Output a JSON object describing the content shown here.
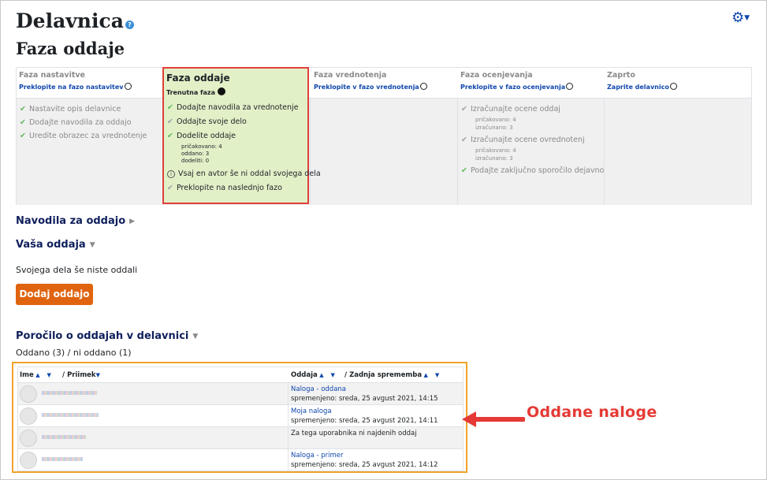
{
  "page": {
    "title": "Delavnica",
    "subtitle": "Faza oddaje",
    "help_icon": "question-circle-icon",
    "settings_icon": "gear-icon"
  },
  "phases": [
    {
      "name": "Faza nastavitve",
      "link": "Preklopite na fazo nastavitev",
      "tasks": [
        {
          "label": "Nastavite opis delavnice"
        },
        {
          "label": "Dodajte navodila za oddajo"
        },
        {
          "label": "Uredite obrazec za vrednotenje"
        }
      ]
    },
    {
      "name": "Faza oddaje",
      "current": "Trenutna faza",
      "tasks": [
        {
          "label": "Dodajte navodila za vrednotenje"
        },
        {
          "label": "Oddajte svoje delo"
        },
        {
          "label": "Dodelite oddaje",
          "details": [
            "pričakovano: 4",
            "oddano: 3",
            "dodeliti: 0"
          ]
        },
        {
          "label": "Vsaj en avtor še ni oddal svojega dela"
        },
        {
          "label": "Preklopite na naslednjo fazo"
        }
      ]
    },
    {
      "name": "Faza vrednotenja",
      "link": "Preklopite v fazo vrednotenja",
      "tasks": []
    },
    {
      "name": "Faza ocenjevanja",
      "link": "Preklopite v fazo ocenjevanja",
      "tasks": [
        {
          "label": "Izračunajte ocene oddaj",
          "details": [
            "pričakovano: 4",
            "izračunano: 3"
          ]
        },
        {
          "label": "Izračunajte ocene ovrednotenj",
          "details": [
            "pričakovano: 4",
            "izračunano: 3"
          ]
        },
        {
          "label": "Podajte zaključno sporočilo dejavnosti"
        }
      ]
    },
    {
      "name": "Zaprto",
      "link": "Zaprite delavnico",
      "tasks": []
    }
  ],
  "instructions": {
    "label": "Navodila za oddajo"
  },
  "your_submission": {
    "label": "Vaša oddaja",
    "status": "Svojega dela še niste oddali",
    "button": "Dodaj oddajo"
  },
  "report": {
    "label": "Poročilo o oddajah v delavnici",
    "summary": "Oddano (3) / ni oddano (1)",
    "headers": {
      "first": "Ime",
      "last": "/ Priimek",
      "submission": "Oddaja",
      "modified": "/ Zadnja sprememba"
    },
    "rows": [
      {
        "link": "Naloga - oddana",
        "date": "spremenjeno: sreda, 25 avgust 2021, 14:15"
      },
      {
        "link": "Moja naloga",
        "date": "spremenjeno: sreda, 25 avgust 2021, 14:11"
      },
      {
        "text": "Za tega uporabnika ni najdenih oddaj"
      },
      {
        "link": "Naloga - primer",
        "date": "spremenjeno: sreda, 25 avgust 2021, 14:12"
      }
    ]
  },
  "annotation": {
    "label": "Oddane naloge",
    "color": "#e53935"
  },
  "colors": {
    "link": "#0f47ad",
    "button": "#e0640f",
    "active_phase_bg": "#e2f0c8",
    "active_phase_border": "#e0403a",
    "table_highlight": "#f0a32a",
    "check": "#5cb85c"
  }
}
